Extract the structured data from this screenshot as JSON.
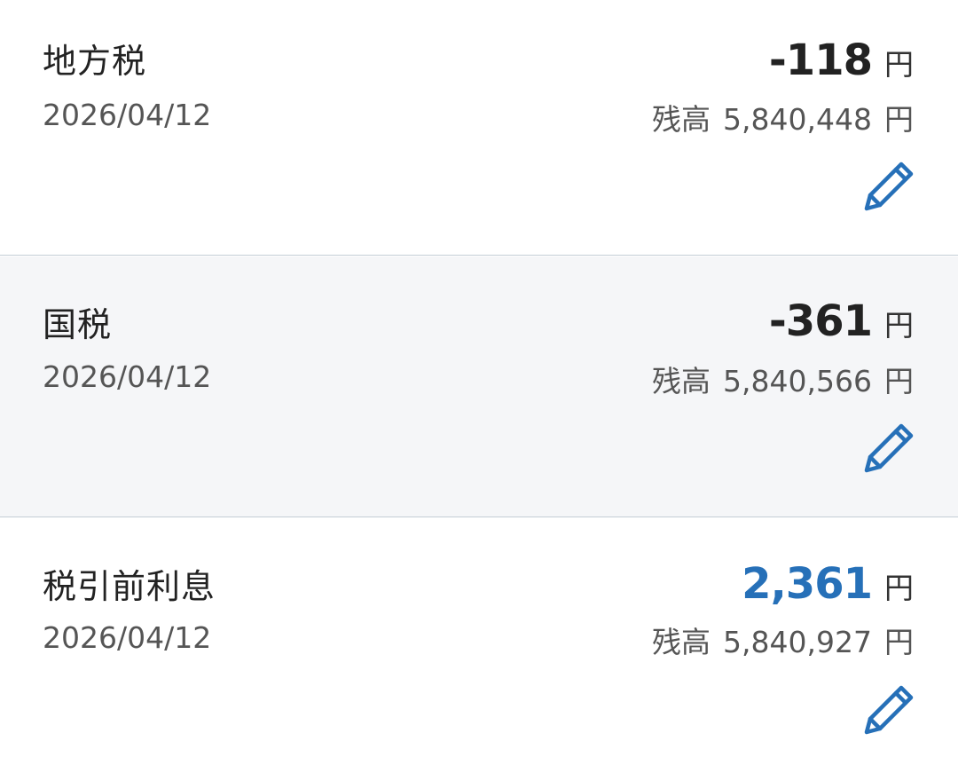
{
  "colors": {
    "positive_amount": "#2670b8",
    "negative_amount": "#222222",
    "icon_blue": "#2670b8",
    "alt_row_background": "#f5f6f8",
    "divider": "#c4cdd6"
  },
  "transactions": [
    {
      "name": "地方税",
      "date": "2026/04/12",
      "amount": "-118",
      "amount_unit": "円",
      "balance_label": "残高",
      "balance": "5,840,448",
      "balance_unit": "円",
      "edit_icon": "pencil-icon"
    },
    {
      "name": "国税",
      "date": "2026/04/12",
      "amount": "-361",
      "amount_unit": "円",
      "balance_label": "残高",
      "balance": "5,840,566",
      "balance_unit": "円",
      "edit_icon": "pencil-icon"
    },
    {
      "name": "税引前利息",
      "date": "2026/04/12",
      "amount": "2,361",
      "amount_unit": "円",
      "balance_label": "残高",
      "balance": "5,840,927",
      "balance_unit": "円",
      "edit_icon": "pencil-icon"
    }
  ]
}
